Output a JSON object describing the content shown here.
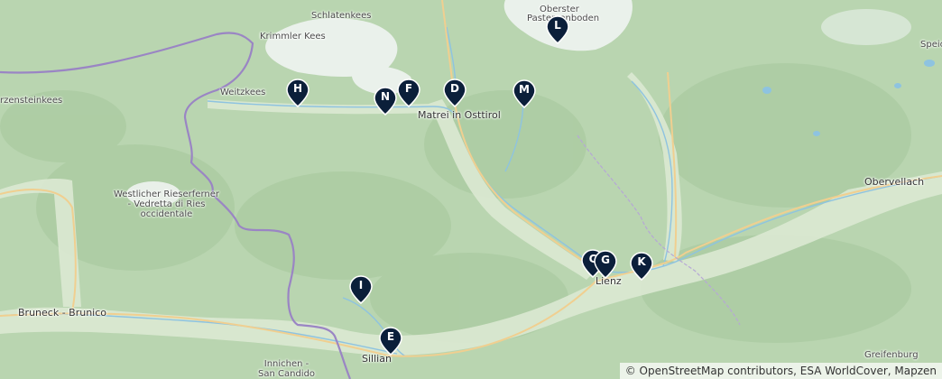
{
  "map": {
    "places": [
      {
        "key": "schlatenkees",
        "label": "Schlatenkees"
      },
      {
        "key": "oberster",
        "label": "Oberster"
      },
      {
        "key": "pasterzenboden",
        "label": "Pasterzenboden"
      },
      {
        "key": "krimmler",
        "label": "Krimmler Kees"
      },
      {
        "key": "rzenstein",
        "label": "rzensteinkees"
      },
      {
        "key": "weitz",
        "label": "Weitzkees"
      },
      {
        "key": "matrei",
        "label": "Matrei in Osttirol"
      },
      {
        "key": "speich",
        "label": "Speich"
      },
      {
        "key": "obervellach",
        "label": "Obervellach"
      },
      {
        "key": "rieserferner",
        "label": "Westlicher Rieserferner\n- Vedretta di Ries\noccidentale"
      },
      {
        "key": "bruneck",
        "label": "Bruneck - Brunico"
      },
      {
        "key": "lienz",
        "label": "Lienz"
      },
      {
        "key": "sillian",
        "label": "Sillian"
      },
      {
        "key": "innichen",
        "label": "Innichen -\nSan Candido"
      },
      {
        "key": "greifenburg",
        "label": "Greifenburg"
      }
    ],
    "markers": [
      "L",
      "H",
      "N",
      "F",
      "D",
      "M",
      "I",
      "E",
      "C",
      "G",
      "K"
    ],
    "attribution": "© OpenStreetMap contributors, ESA WorldCover, Mapzen",
    "colors": {
      "land": "#b9d5b0",
      "valley": "#dce9d3",
      "glacier": "#f4f6f6",
      "water": "#8ec3e0",
      "border": "#9a85c4",
      "road": "#f0cf90",
      "marker": "#0b1f3a"
    }
  }
}
